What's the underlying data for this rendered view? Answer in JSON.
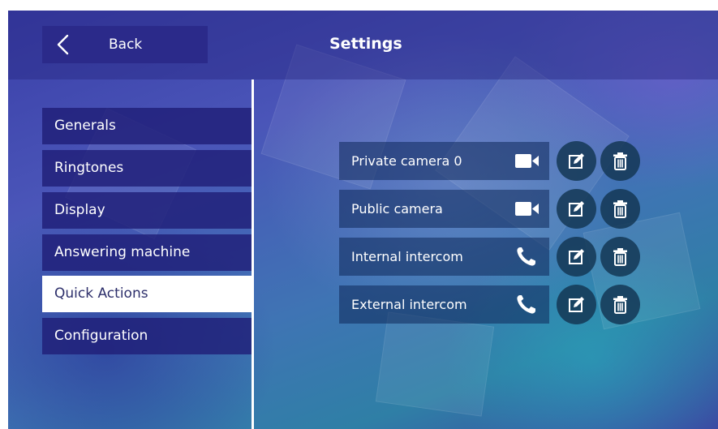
{
  "header": {
    "back_label": "Back",
    "title": "Settings"
  },
  "menu": {
    "items": [
      {
        "label": "Generals",
        "selected": false
      },
      {
        "label": "Ringtones",
        "selected": false
      },
      {
        "label": "Display",
        "selected": false
      },
      {
        "label": "Answering machine",
        "selected": false
      },
      {
        "label": "Quick Actions",
        "selected": true
      },
      {
        "label": "Configuration",
        "selected": false
      }
    ]
  },
  "quick_actions": [
    {
      "label": "Private camera 0",
      "type_icon": "video-camera-icon"
    },
    {
      "label": "Public camera",
      "type_icon": "video-camera-icon"
    },
    {
      "label": "Internal intercom",
      "type_icon": "phone-handset-icon"
    },
    {
      "label": "External intercom",
      "type_icon": "phone-handset-icon"
    }
  ],
  "icons": {
    "back": "chevron-left-icon",
    "edit": "edit-icon",
    "delete": "trash-icon"
  },
  "colors": {
    "back_button": "#2b2a8a",
    "menu_item": "#201e78",
    "menu_selected": "#ffffff",
    "menu_selected_text": "#2d2f6b",
    "circle_button": "#143755"
  }
}
